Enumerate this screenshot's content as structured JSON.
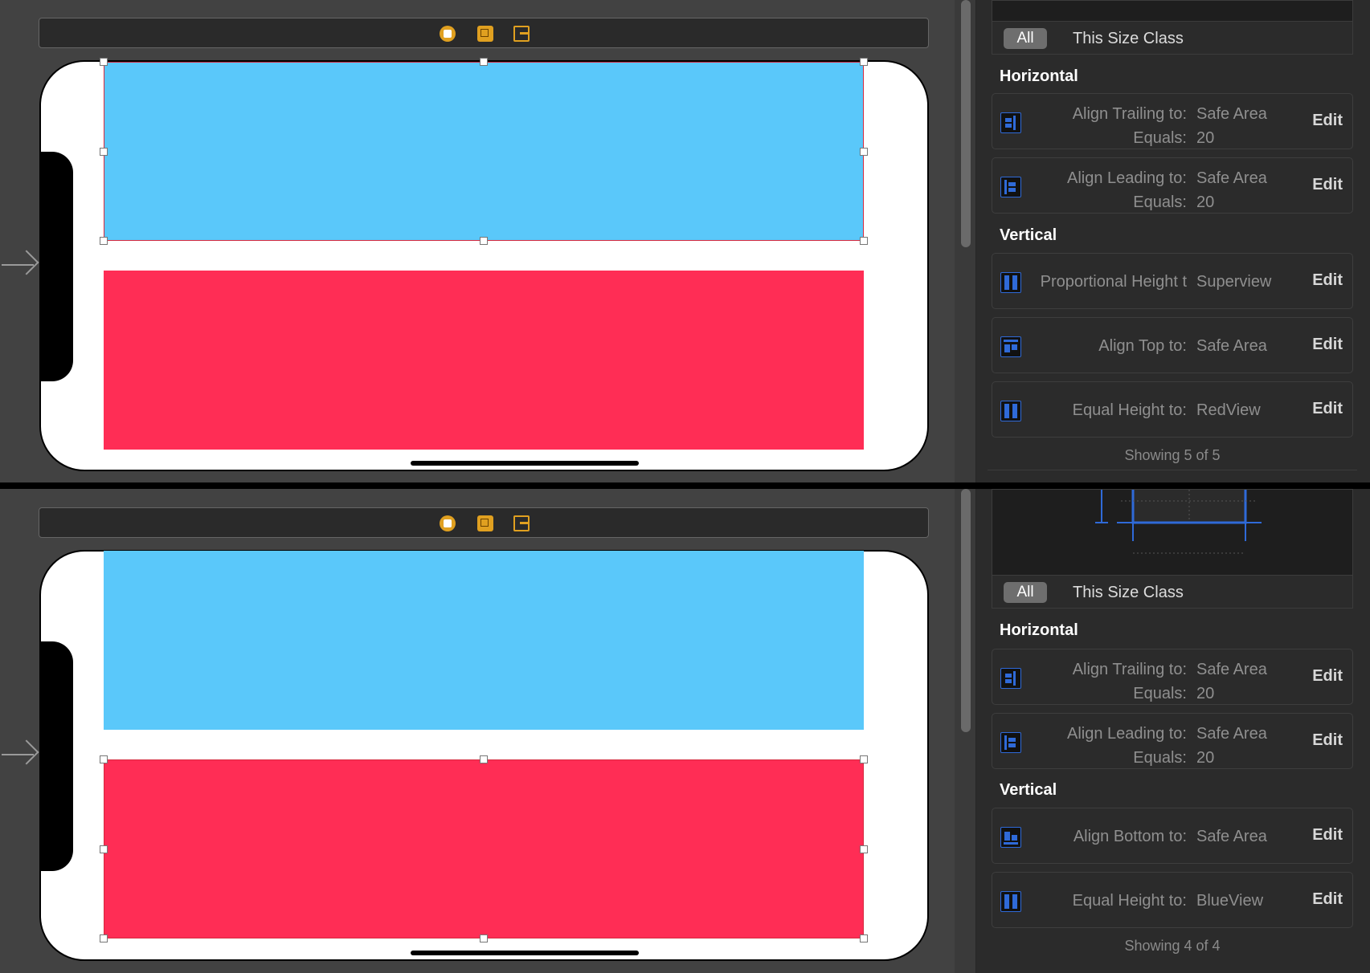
{
  "colors": {
    "blue_view": "#5ac8fa",
    "red_view": "#ff2d55",
    "constraint_icon": "#2f6ad8"
  },
  "scene_icons": [
    "view-controller-icon",
    "first-responder-icon",
    "exit-icon"
  ],
  "panels": [
    {
      "selected_view": "blue",
      "size_class": {
        "all": "All",
        "this": "This Size Class"
      },
      "horizontal_title": "Horizontal",
      "vertical_title": "Vertical",
      "horizontal": [
        {
          "icon": "align-trailing-icon",
          "line1_label": "Align Trailing to:",
          "line1_value": "Safe Area",
          "line2_label": "Equals:",
          "line2_value": "20",
          "edit": "Edit"
        },
        {
          "icon": "align-leading-icon",
          "line1_label": "Align Leading to:",
          "line1_value": "Safe Area",
          "line2_label": "Equals:",
          "line2_value": "20",
          "edit": "Edit"
        }
      ],
      "vertical": [
        {
          "icon": "proportional-height-icon",
          "line1_label": "Proportional Height t",
          "line1_value": "Superview",
          "edit": "Edit"
        },
        {
          "icon": "align-top-icon",
          "line1_label": "Align Top to:",
          "line1_value": "Safe Area",
          "edit": "Edit"
        },
        {
          "icon": "equal-height-icon",
          "line1_label": "Equal Height to:",
          "line1_value": "RedView",
          "edit": "Edit"
        }
      ],
      "showing": "Showing 5 of 5"
    },
    {
      "selected_view": "red",
      "size_class": {
        "all": "All",
        "this": "This Size Class"
      },
      "horizontal_title": "Horizontal",
      "vertical_title": "Vertical",
      "horizontal": [
        {
          "icon": "align-trailing-icon",
          "line1_label": "Align Trailing to:",
          "line1_value": "Safe Area",
          "line2_label": "Equals:",
          "line2_value": "20",
          "edit": "Edit"
        },
        {
          "icon": "align-leading-icon",
          "line1_label": "Align Leading to:",
          "line1_value": "Safe Area",
          "line2_label": "Equals:",
          "line2_value": "20",
          "edit": "Edit"
        }
      ],
      "vertical": [
        {
          "icon": "align-bottom-icon",
          "line1_label": "Align Bottom to:",
          "line1_value": "Safe Area",
          "edit": "Edit"
        },
        {
          "icon": "equal-height-icon",
          "line1_label": "Equal Height to:",
          "line1_value": "BlueView",
          "edit": "Edit"
        }
      ],
      "showing": "Showing 4 of 4"
    }
  ]
}
